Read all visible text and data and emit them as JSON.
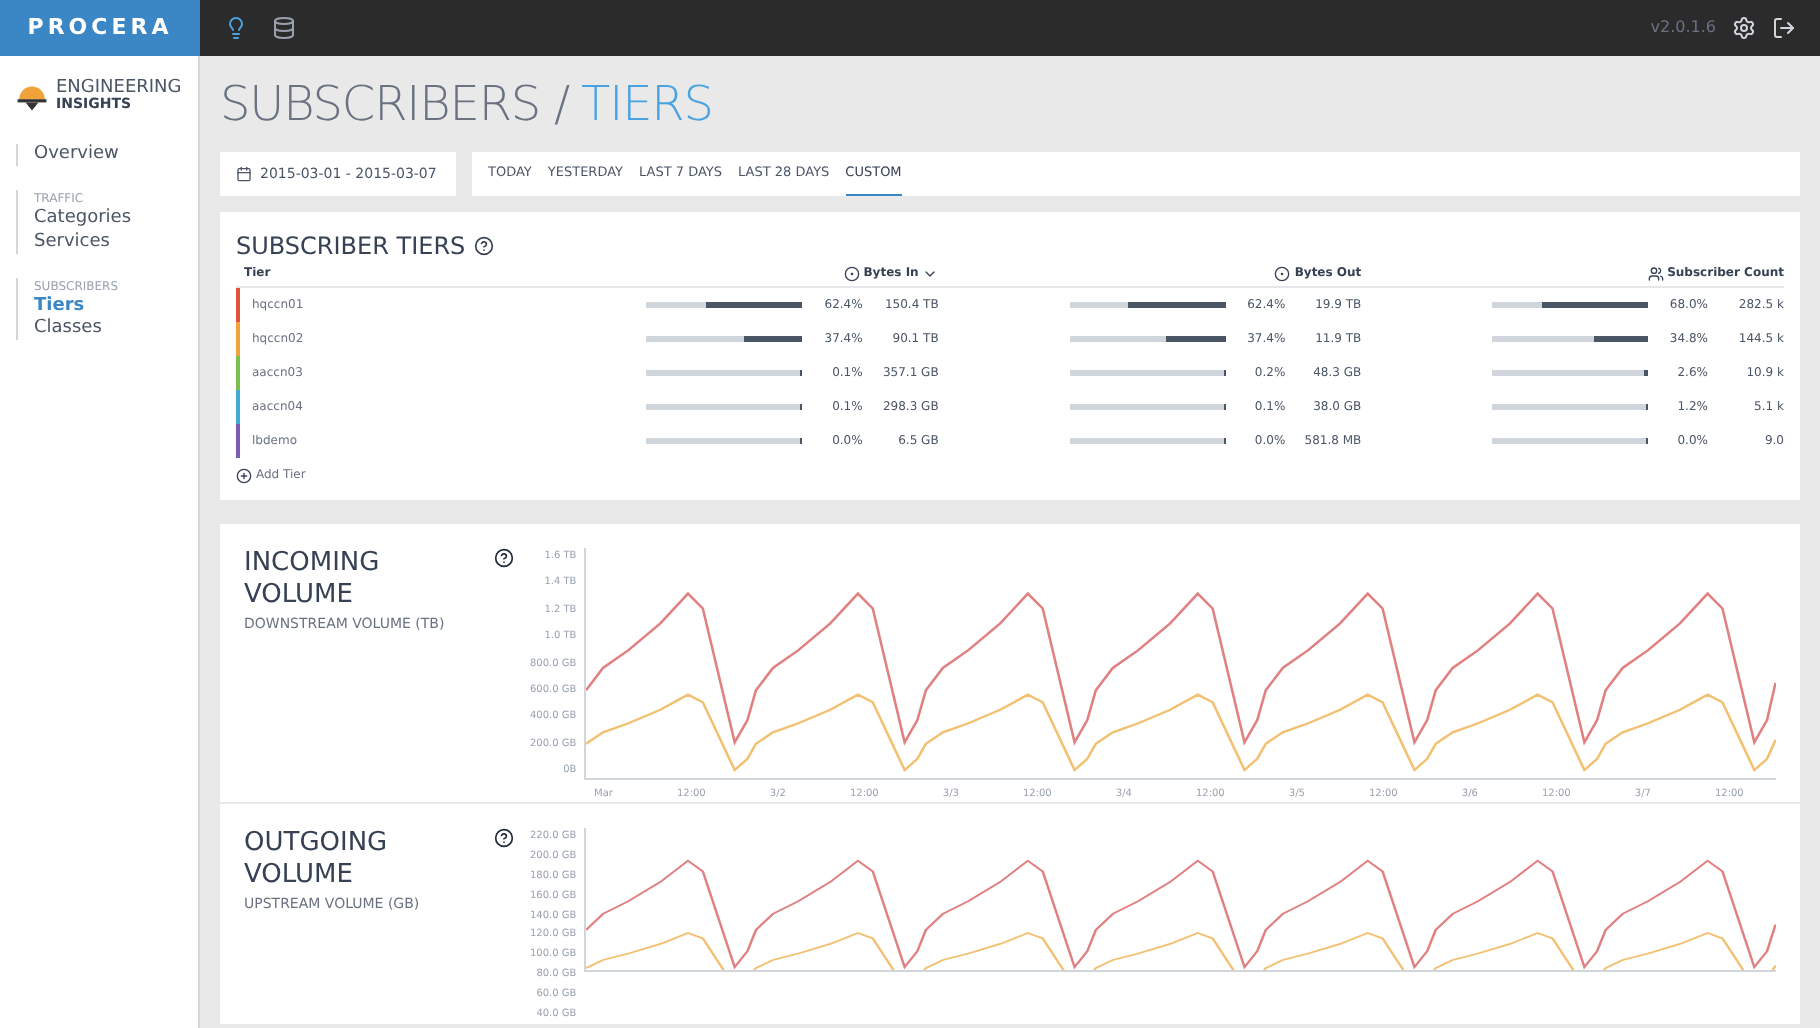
{
  "topbar": {
    "brand": "PROCERA",
    "version": "v2.0.1.6"
  },
  "sidebar": {
    "logo_line1": "ENGINEERING",
    "logo_line2": "INSIGHTS",
    "groups": [
      {
        "items": [
          {
            "label": "Overview",
            "selected": false
          }
        ]
      },
      {
        "heading": "TRAFFIC",
        "items": [
          {
            "label": "Categories",
            "selected": false
          },
          {
            "label": "Services",
            "selected": false
          }
        ]
      },
      {
        "heading": "SUBSCRIBERS",
        "items": [
          {
            "label": "Tiers",
            "selected": true
          },
          {
            "label": "Classes",
            "selected": false
          }
        ]
      }
    ]
  },
  "page_title": {
    "parent": "SUBSCRIBERS /",
    "current": "TIERS"
  },
  "date_range": "2015-03-01 - 2015-03-07",
  "range_tabs": [
    {
      "label": "TODAY",
      "selected": false
    },
    {
      "label": "YESTERDAY",
      "selected": false
    },
    {
      "label": "LAST 7 DAYS",
      "selected": false
    },
    {
      "label": "LAST 28 DAYS",
      "selected": false
    },
    {
      "label": "CUSTOM",
      "selected": true
    }
  ],
  "tiers_card": {
    "title": "SUBSCRIBER TIERS",
    "columns": [
      "Tier",
      "Bytes In",
      "Bytes Out",
      "Subscriber Count"
    ],
    "rows": [
      {
        "tier": "hqccn01",
        "color": "#e0533f",
        "bytes_in": {
          "level": 0.624,
          "pct": "62.4%",
          "value": "150.4 TB"
        },
        "bytes_out": {
          "level": 0.624,
          "pct": "62.4%",
          "value": "19.9 TB"
        },
        "subscribers": {
          "level": 0.68,
          "pct": "68.0%",
          "value": "282.5 k"
        }
      },
      {
        "tier": "hqccn02",
        "color": "#f0a33a",
        "bytes_in": {
          "level": 0.374,
          "pct": "37.4%",
          "value": "90.1 TB"
        },
        "bytes_out": {
          "level": 0.374,
          "pct": "37.4%",
          "value": "11.9 TB"
        },
        "subscribers": {
          "level": 0.348,
          "pct": "34.8%",
          "value": "144.5 k"
        }
      },
      {
        "tier": "aaccn03",
        "color": "#7cbf4a",
        "bytes_in": {
          "level": 0.001,
          "pct": "0.1%",
          "value": "357.1 GB"
        },
        "bytes_out": {
          "level": 0.002,
          "pct": "0.2%",
          "value": "48.3 GB"
        },
        "subscribers": {
          "level": 0.026,
          "pct": "2.6%",
          "value": "10.9 k"
        }
      },
      {
        "tier": "aaccn04",
        "color": "#3fa9d8",
        "bytes_in": {
          "level": 0.001,
          "pct": "0.1%",
          "value": "298.3 GB"
        },
        "bytes_out": {
          "level": 0.001,
          "pct": "0.1%",
          "value": "38.0 GB"
        },
        "subscribers": {
          "level": 0.012,
          "pct": "1.2%",
          "value": "5.1 k"
        }
      },
      {
        "tier": "lbdemo",
        "color": "#7b5bb5",
        "bytes_in": {
          "level": 0.0,
          "pct": "0.0%",
          "value": "6.5 GB"
        },
        "bytes_out": {
          "level": 0.0,
          "pct": "0.0%",
          "value": "581.8 MB"
        },
        "subscribers": {
          "level": 0.0,
          "pct": "0.0%",
          "value": "9.0"
        }
      }
    ],
    "add_label": "Add Tier"
  },
  "volume_cards": [
    {
      "title": "INCOMING VOLUME",
      "subtitle": "DOWNSTREAM VOLUME (TB)",
      "y_ticks": [
        "1.6 TB",
        "1.4 TB",
        "1.2 TB",
        "1.0 TB",
        "800.0 GB",
        "600.0 GB",
        "400.0 GB",
        "200.0 GB",
        "0B"
      ],
      "x_ticks": [
        "Mar",
        "12:00",
        "3/2",
        "12:00",
        "3/3",
        "12:00",
        "3/4",
        "12:00",
        "3/5",
        "12:00",
        "3/6",
        "12:00",
        "3/7",
        "12:00"
      ]
    },
    {
      "title": "OUTGOING VOLUME",
      "subtitle": "UPSTREAM VOLUME (GB)",
      "y_ticks": [
        "220.0 GB",
        "200.0 GB",
        "180.0 GB",
        "160.0 GB",
        "140.0 GB",
        "120.0 GB",
        "100.0 GB",
        "80.0 GB",
        "60.0 GB",
        "40.0 GB"
      ]
    }
  ]
}
